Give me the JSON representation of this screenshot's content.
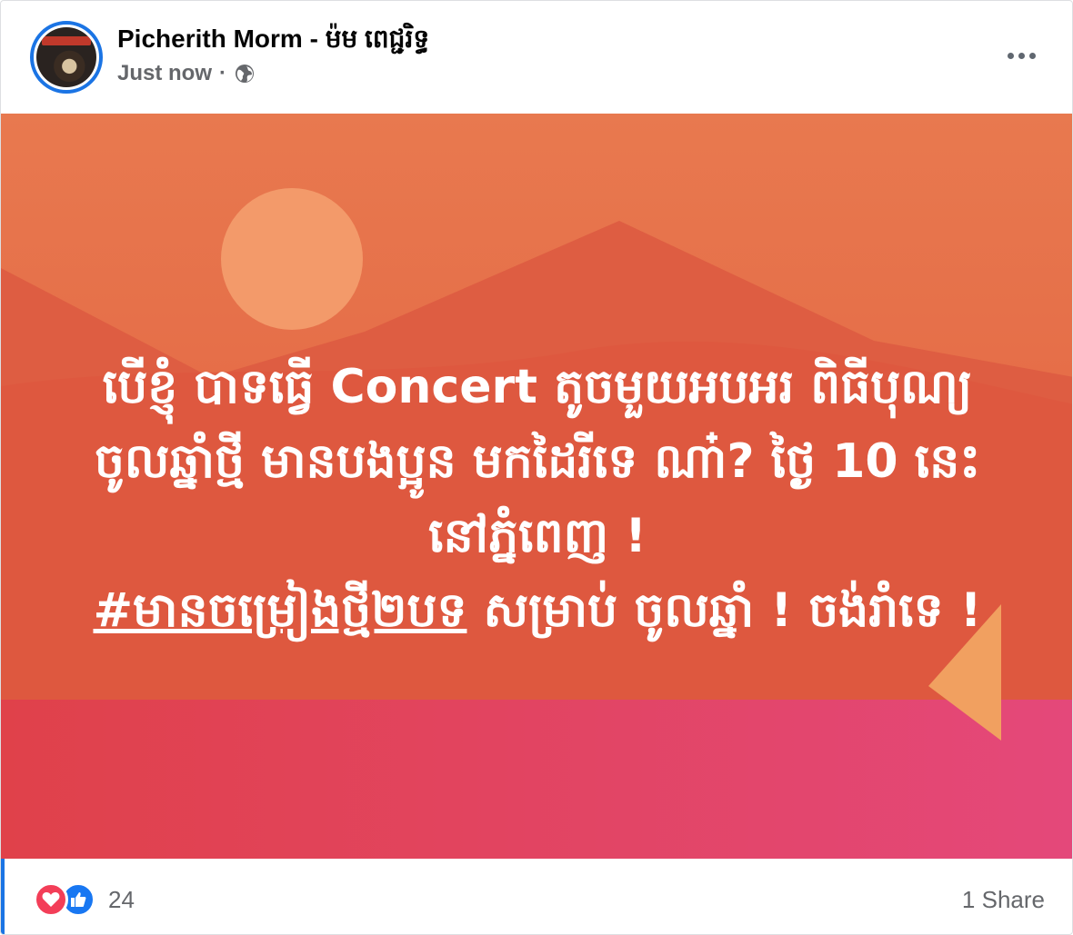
{
  "post": {
    "author": "Picherith Morm - ម៉ម ពេជ្ជរិទ្ធ",
    "timestamp": "Just now",
    "separator": "·",
    "privacy_icon": "globe-icon",
    "more_icon": "more-options-icon",
    "text_lines": [
      "បើខ្ញុំ បាទធ្វើ Concert តូចមួយអបអរ ពិធីបុណ្យ",
      "ចូលឆ្នាំថ្មី មានបងប្អូន មកដៃរីទេ ណា៎? ថ្ងៃ 10 នេះ",
      "នៅភ្នំពេញ !"
    ],
    "hashtag": "#មានចម្រៀងថ្មី២បទ",
    "text_after_hashtag": " សម្រាប់ ចូលឆ្នាំ ! ចង់រាំទេ !"
  },
  "background": {
    "sky_top": "#e8744f",
    "sky_bottom": "#e0563a",
    "sun": "#f39c6b",
    "mountain": "#de5a40",
    "water": "#e2446a"
  },
  "footer": {
    "reaction_icons": [
      "love-icon",
      "like-icon"
    ],
    "reaction_count": "24",
    "share_count": "1 Share"
  }
}
